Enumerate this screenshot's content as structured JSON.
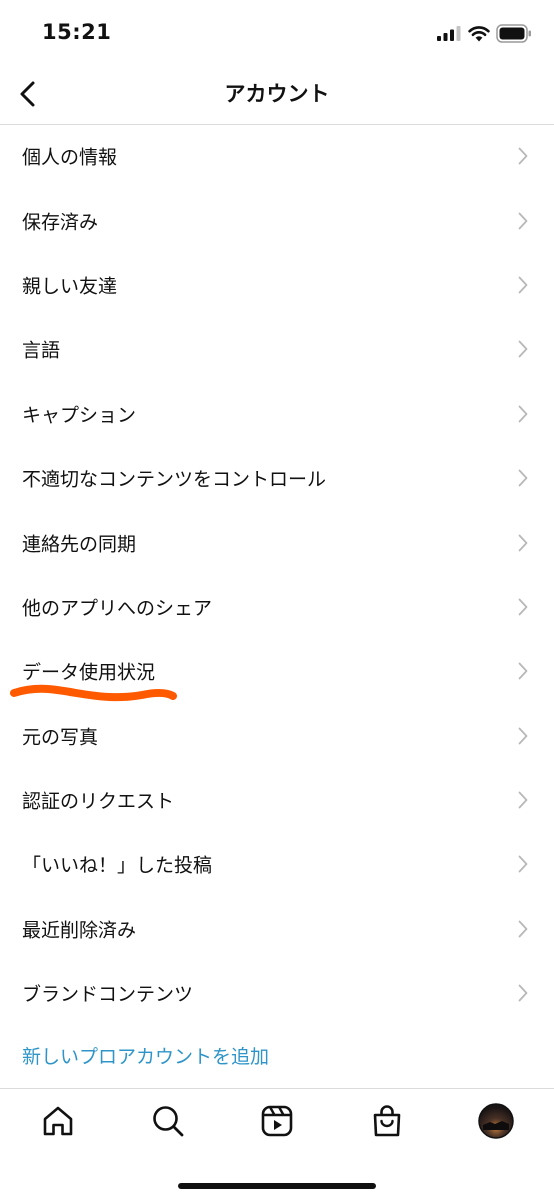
{
  "status_bar": {
    "time": "15:21",
    "icons": [
      "signal-icon",
      "wifi-icon",
      "battery-icon"
    ]
  },
  "header": {
    "title": "アカウント",
    "back_icon": "chevron-left-icon"
  },
  "menu": {
    "items": [
      {
        "label": "個人の情報"
      },
      {
        "label": "保存済み"
      },
      {
        "label": "親しい友達"
      },
      {
        "label": "言語"
      },
      {
        "label": "キャプション"
      },
      {
        "label": "不適切なコンテンツをコントロール"
      },
      {
        "label": "連絡先の同期"
      },
      {
        "label": "他のアプリへのシェア"
      },
      {
        "label": "データ使用状況"
      },
      {
        "label": "元の写真"
      },
      {
        "label": "認証のリクエスト"
      },
      {
        "label": "「いいね！」した投稿"
      },
      {
        "label": "最近削除済み"
      },
      {
        "label": "ブランドコンテンツ"
      }
    ],
    "add_account_link": "新しいプロアカウントを追加"
  },
  "annotation": {
    "color": "#ff5a00",
    "highlighted_item": "データ使用状況"
  },
  "colors": {
    "link": "#2f95c8",
    "divider": "#dbdbdb",
    "chevron": "#b8b8b8"
  },
  "bottom_nav": {
    "items": [
      "home-icon",
      "search-icon",
      "reels-icon",
      "shop-icon",
      "profile-avatar"
    ]
  }
}
